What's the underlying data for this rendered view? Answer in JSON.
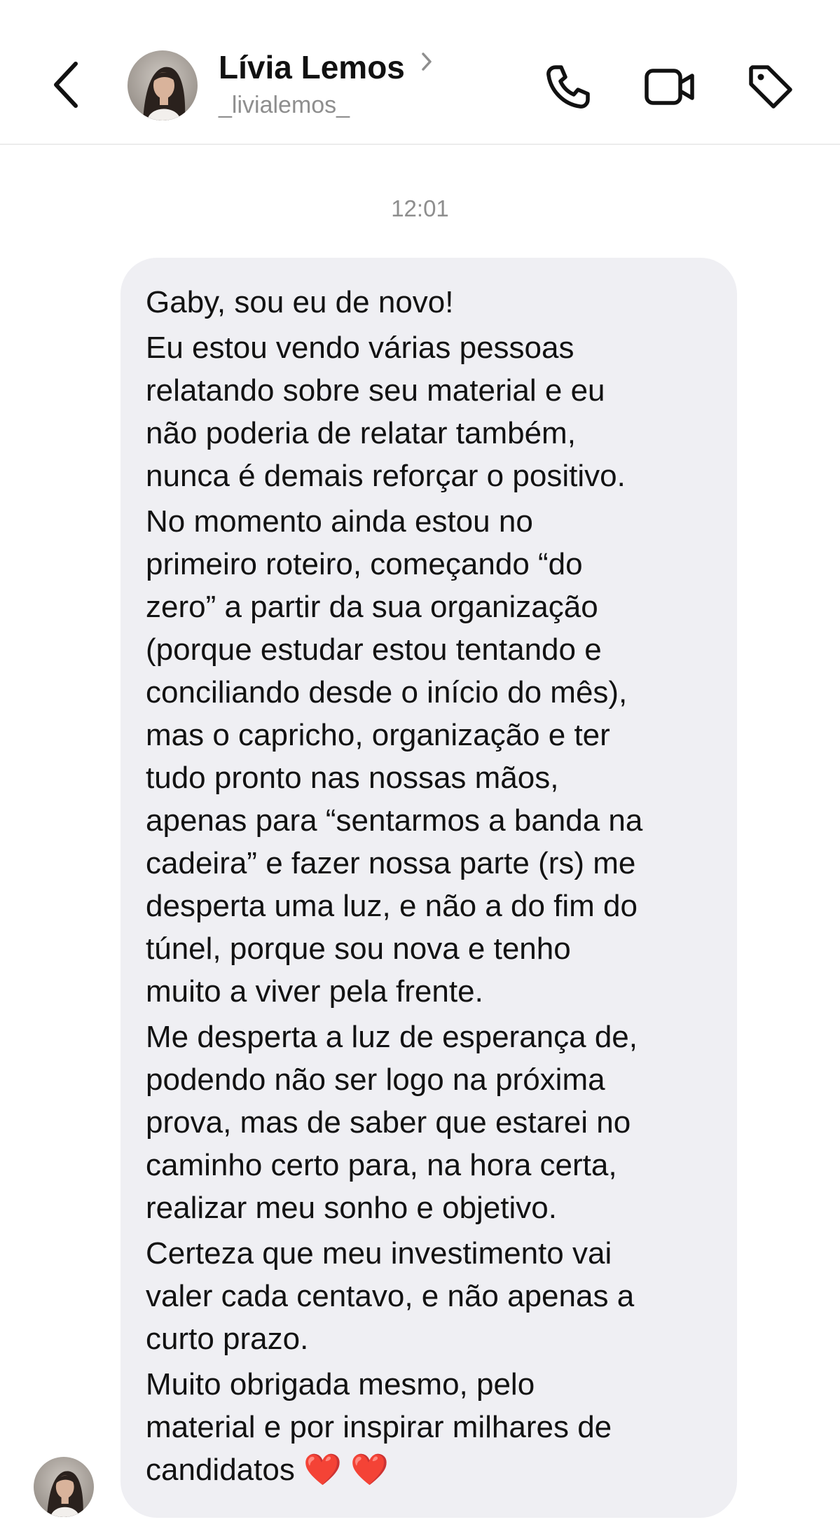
{
  "header": {
    "contact_name": "Lívia Lemos",
    "contact_handle": "_livialemos_",
    "icons": [
      "back-chevron-icon",
      "profile-chevron-icon",
      "phone-icon",
      "video-camera-icon",
      "tag-icon"
    ]
  },
  "thread": {
    "timestamp": "12:01",
    "message": {
      "paragraphs": [
        "Gaby, sou eu de novo!",
        "Eu estou vendo várias pessoas\nrelatando sobre seu material e eu\nnão poderia de relatar também,\nnunca é demais reforçar o positivo.",
        "No momento ainda estou no\nprimeiro roteiro, começando “do\nzero” a partir da sua organização\n(porque estudar estou tentando e\nconciliando desde o início do mês),\nmas o capricho, organização e ter\ntudo pronto nas nossas mãos,\napenas para “sentarmos a banda na\ncadeira” e fazer nossa parte (rs) me\ndesperta uma luz, e não a do fim do\ntúnel, porque sou nova e tenho\nmuito a viver pela frente.",
        "Me desperta a luz de esperança de,\npodendo não ser logo na próxima\nprova, mas de saber que estarei no\ncaminho certo para, na hora certa,\nrealizar meu sonho e objetivo.",
        "Certeza que meu investimento vai\nvaler cada centavo, e não apenas a\ncurto prazo.",
        "Muito obrigada mesmo, pelo\nmaterial e por inspirar milhares de\ncandidatos ❤️ ❤️"
      ]
    }
  },
  "colors": {
    "bubble_bg": "#efeff3",
    "text": "#121212",
    "secondary_text": "#8e8e8e",
    "divider": "#ececec",
    "heart": "#e0151b"
  }
}
